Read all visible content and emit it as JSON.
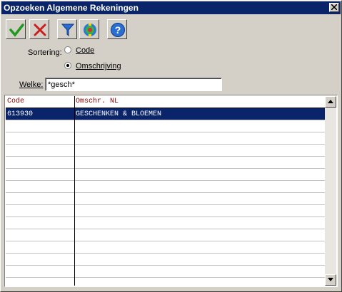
{
  "window": {
    "title": "Opzoeken Algemene Rekeningen"
  },
  "toolbar": {
    "ok": "check-icon",
    "cancel": "cross-icon",
    "filter": "funnel-icon",
    "target": "target-icon",
    "help": "help-icon"
  },
  "sort": {
    "label": "Sortering:",
    "options": [
      {
        "label": "Code",
        "selected": false
      },
      {
        "label": "Omschrijving",
        "selected": true
      }
    ]
  },
  "search": {
    "label": "Welke:",
    "value": "*gesch*"
  },
  "table": {
    "columns": [
      "Code",
      "Omschr. NL"
    ],
    "rows": [
      {
        "code": "613930",
        "desc": "GESCHENKEN & BLOEMEN"
      }
    ]
  },
  "colors": {
    "titlebar": "#0a246a",
    "selection": "#0a246a",
    "header_text": "#800000"
  }
}
